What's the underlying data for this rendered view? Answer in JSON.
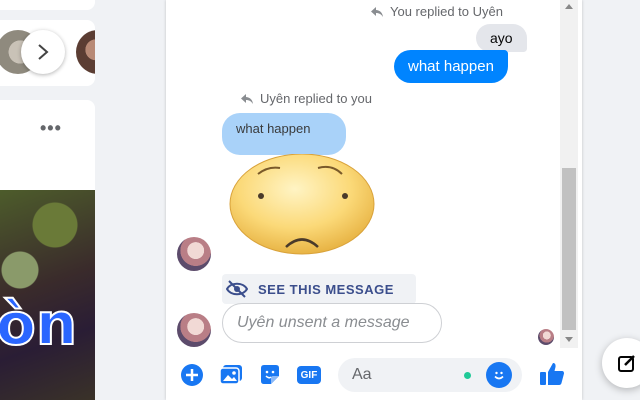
{
  "conversation": {
    "reply_meta_1": "You replied to Uyên",
    "quoted_own": "ayo",
    "sent_message": "what happen",
    "reply_meta_2": "Uyên replied to you",
    "quoted_incoming": "what happen",
    "see_message_label": "SEE THIS MESSAGE",
    "unsent_notice": "Uyên unsent a message"
  },
  "composer": {
    "input_placeholder": "Aa",
    "gif_label": "GIF"
  },
  "feed": {
    "post_overlay_text": "òn"
  },
  "colors": {
    "accent": "#0084ff",
    "quote_bubble": "#a9d2f9",
    "messenger_blue": "#1877f2"
  }
}
